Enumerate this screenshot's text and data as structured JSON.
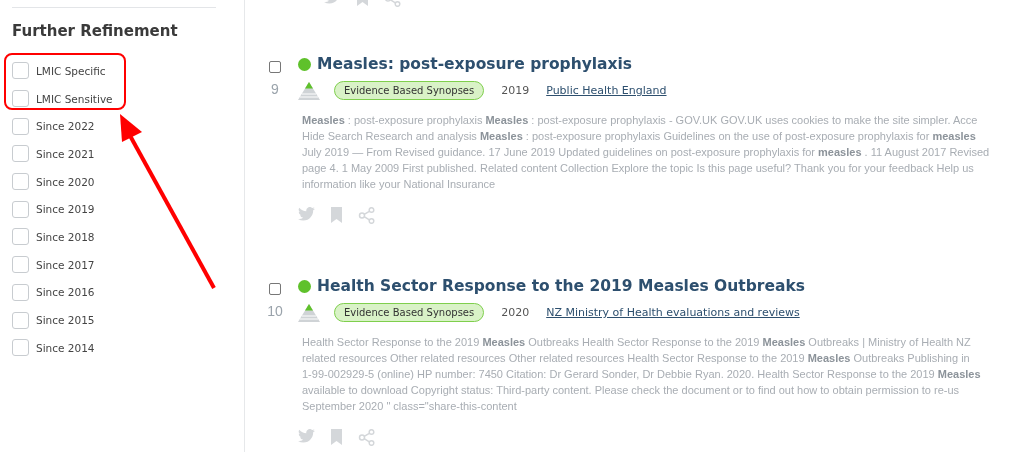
{
  "sidebar": {
    "title": "Further Refinement",
    "filters": [
      {
        "label": "LMIC Specific",
        "checked": false,
        "highlighted": true
      },
      {
        "label": "LMIC Sensitive",
        "checked": false,
        "highlighted": true
      },
      {
        "label": "Since 2022",
        "checked": false,
        "highlighted": false
      },
      {
        "label": "Since 2021",
        "checked": false,
        "highlighted": false
      },
      {
        "label": "Since 2020",
        "checked": false,
        "highlighted": false
      },
      {
        "label": "Since 2019",
        "checked": false,
        "highlighted": false
      },
      {
        "label": "Since 2018",
        "checked": false,
        "highlighted": false
      },
      {
        "label": "Since 2017",
        "checked": false,
        "highlighted": false
      },
      {
        "label": "Since 2016",
        "checked": false,
        "highlighted": false
      },
      {
        "label": "Since 2015",
        "checked": false,
        "highlighted": false
      },
      {
        "label": "Since 2014",
        "checked": false,
        "highlighted": false
      }
    ]
  },
  "results": [
    {
      "number": "9",
      "checked": false,
      "title": "Measles: post-exposure prophylaxis",
      "badge": "Evidence Based Synopses",
      "year": "2019",
      "source": "Public Health England",
      "snippet_lines": [
        " **Measles** : post-exposure prophylaxis  **Measles** : post-exposure prophylaxis - GOV.UK GOV.UK uses cookies to make the site simpler. Acce",
        "Hide Search Research and analysis  **Measles** : post-exposure prophylaxis Guidelines on the use of post-exposure prophylaxis for  **measles**",
        "July 2019 — From Revised guidance. 17 June 2019 Updated guidelines on post-exposure prophylaxis for  **measles** . 11 August 2017 Revised",
        "page 4. 1 May 2009 First published. Related content Collection Explore the topic Is this page useful? Thank you for your feedback Help us",
        "information like your National Insurance"
      ]
    },
    {
      "number": "10",
      "checked": false,
      "title": "Health Sector Response to the 2019 Measles Outbreaks",
      "badge": "Evidence Based Synopses",
      "year": "2020",
      "source": "NZ Ministry of Health evaluations and reviews",
      "snippet_lines": [
        "Health Sector Response to the 2019  **Measles**  Outbreaks Health Sector Response to the 2019  **Measles**  Outbreaks | Ministry of Health NZ",
        "related resources Other related resources Other related resources Health Sector Response to the 2019  **Measles**  Outbreaks Publishing in",
        "1-99-002929-5 (online) HP number: 7450 Citation: Dr Gerard Sonder, Dr Debbie Ryan. 2020. Health Sector Response to the 2019  **Measles**",
        "available to download Copyright status: Third-party content. Please check the document or to find out how to obtain permission to re-us",
        "September 2020 \" class=\"share-this-content"
      ]
    }
  ]
}
